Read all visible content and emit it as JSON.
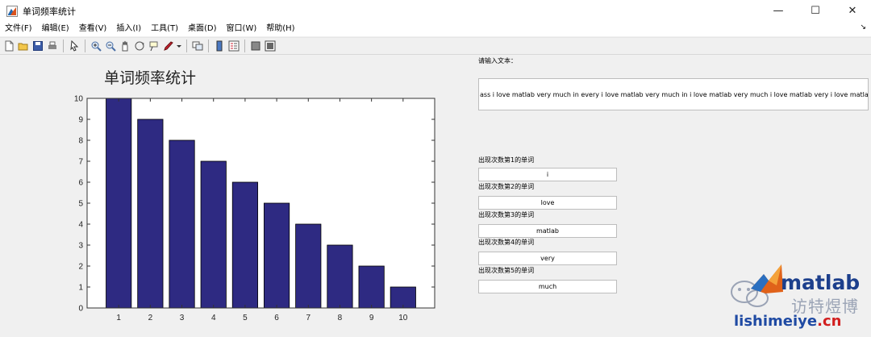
{
  "window": {
    "title": "单词频率统计",
    "controls": {
      "minimize": "—",
      "maximize": "☐",
      "close": "✕"
    }
  },
  "menu": {
    "items": [
      "文件(F)",
      "编辑(E)",
      "查看(V)",
      "插入(I)",
      "工具(T)",
      "桌面(D)",
      "窗口(W)",
      "帮助(H)"
    ],
    "overflow": "↘"
  },
  "toolbar": {
    "icons": [
      "new-file-icon",
      "open-folder-icon",
      "save-icon",
      "print-icon",
      "pointer-icon",
      "zoom-in-icon",
      "zoom-out-icon",
      "pan-hand-icon",
      "rotate-3d-icon",
      "data-cursor-icon",
      "brush-icon",
      "link-plot-icon",
      "colorbar-icon",
      "legend-icon",
      "hide-plot-tools-icon",
      "show-plot-tools-icon"
    ]
  },
  "panel": {
    "input_label": "请输入文本：",
    "input_text": "ass i love matlab very much in every i love matlab very much in i love matlab very much i love matlab very i love matlab i love i",
    "results": [
      {
        "label": "出现次数第1的单词",
        "value": "i"
      },
      {
        "label": "出现次数第2的单词",
        "value": "love"
      },
      {
        "label": "出现次数第3的单词",
        "value": "matlab"
      },
      {
        "label": "出现次数第4的单词",
        "value": "very"
      },
      {
        "label": "出现次数第5的单词",
        "value": "much"
      }
    ]
  },
  "chart_data": {
    "type": "bar",
    "title": "单词频率统计",
    "categories": [
      "1",
      "2",
      "3",
      "4",
      "5",
      "6",
      "7",
      "8",
      "9",
      "10"
    ],
    "values": [
      10,
      9,
      8,
      7,
      6,
      5,
      4,
      3,
      2,
      1
    ],
    "ylim": [
      0,
      10
    ],
    "xlim": [
      0,
      11
    ],
    "yticks": [
      0,
      1,
      2,
      3,
      4,
      5,
      6,
      7,
      8,
      9,
      10
    ],
    "bar_color": "#2e2a82",
    "grid": false,
    "xlabel": "",
    "ylabel": ""
  },
  "watermark": {
    "brand": "matlab",
    "chinese": "访特煜博",
    "site_main": "lishimeiye",
    "site_suffix": ".cn"
  }
}
